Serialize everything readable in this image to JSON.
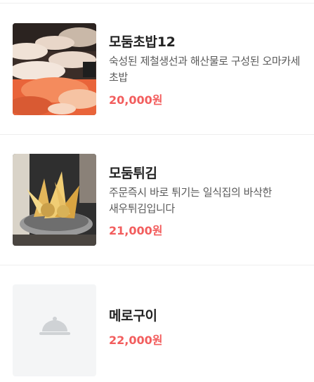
{
  "colors": {
    "name": "#222222",
    "description": "#5a5a5a",
    "price": "#f25d5d",
    "divider": "#eeeeee",
    "placeholder_bg": "#f4f5f6",
    "placeholder_icon": "#cfd2d5"
  },
  "menu": {
    "items": [
      {
        "name": "모둠초밥12",
        "description": "숙성된 제철생선과 해산물로 구성된 오마카세 초밥",
        "price": "20,000원",
        "image": "sushi-photo"
      },
      {
        "name": "모둠튀김",
        "description": "주문즉시 바로 튀기는 일식집의 바삭한 새우튀김입니다",
        "price": "21,000원",
        "image": "tempura-photo"
      },
      {
        "name": "메로구이",
        "description": "",
        "price": "22,000원",
        "image": "dish-cover-icon"
      }
    ]
  }
}
